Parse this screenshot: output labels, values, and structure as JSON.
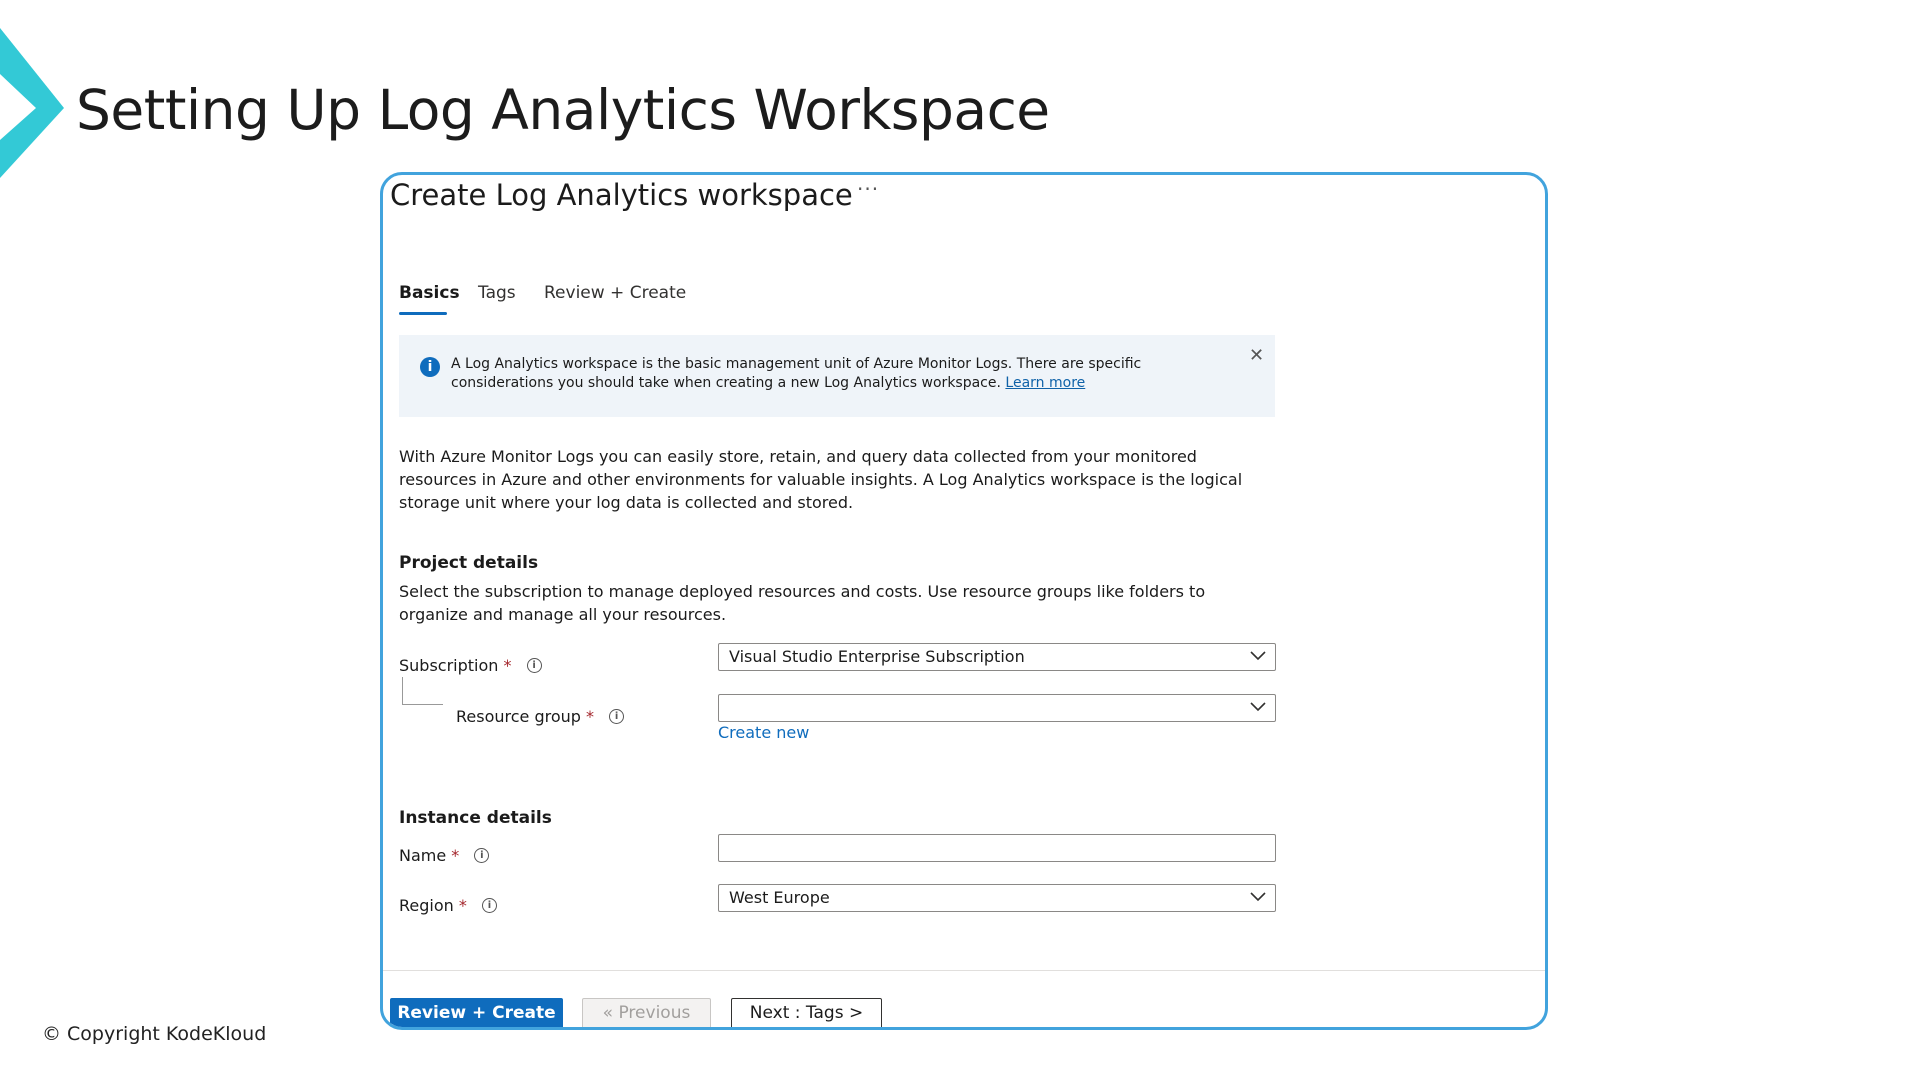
{
  "slide": {
    "title": "Setting Up Log Analytics Workspace",
    "copyright": "© Copyright KodeKloud",
    "accent_color": "#33c9d6"
  },
  "panel": {
    "title": "Create Log Analytics workspace",
    "more_label": "···",
    "tabs": [
      {
        "label": "Basics",
        "active": true
      },
      {
        "label": "Tags",
        "active": false
      },
      {
        "label": "Review + Create",
        "active": false
      }
    ],
    "info_banner": {
      "icon": "info-icon",
      "text": "A Log Analytics workspace is the basic management unit of Azure Monitor Logs. There are specific considerations you should take when creating a new Log Analytics workspace.",
      "link": "Learn more",
      "close_icon": "close-icon"
    },
    "intro": "With Azure Monitor Logs you can easily store, retain, and query data collected from your monitored resources in Azure and other environments for valuable insights. A Log Analytics workspace is the logical storage unit where your log data is collected and stored.",
    "project_details": {
      "heading": "Project details",
      "description": "Select the subscription to manage deployed resources and costs. Use resource groups like folders to organize and manage all your resources.",
      "subscription_label": "Subscription",
      "subscription_value": "Visual Studio Enterprise Subscription",
      "resource_group_label": "Resource group",
      "resource_group_value": "",
      "create_new": "Create new"
    },
    "instance_details": {
      "heading": "Instance details",
      "name_label": "Name",
      "name_value": "",
      "region_label": "Region",
      "region_value": "West Europe"
    },
    "required_mark": "*",
    "footer": {
      "review_create": "Review + Create",
      "previous": "« Previous",
      "next": "Next : Tags >"
    }
  },
  "colors": {
    "panel_border": "#41a3dd",
    "primary_button": "#0f6cbd",
    "info_background": "#eff4f9",
    "required": "#a4262c"
  }
}
